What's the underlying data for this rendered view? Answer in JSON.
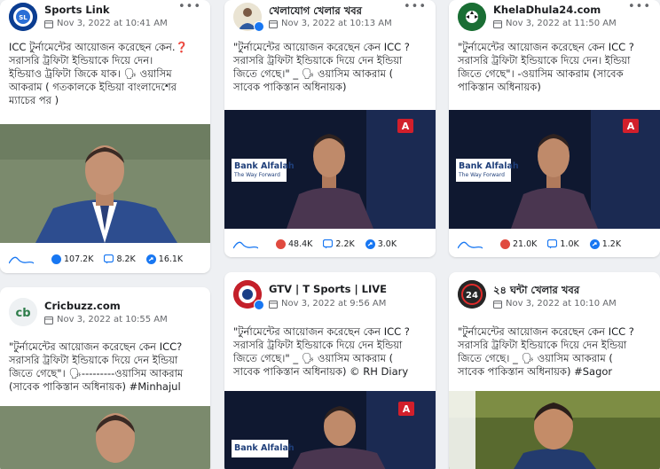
{
  "posts": [
    {
      "page_name": "Sports Link",
      "timestamp": "Nov 3, 2022 at 10:41 AM",
      "text": "ICC টুর্নামেন্টের আয়োজন করেছেন কেন.❓\nসরাসরি ট্রফিটা ইন্ডিয়াকে দিয়ে দেন।\nইন্ডিয়াও ট্রফিটা জিকে যাক। 🗣 ওয়াসিম\nআকরাম ( গতকালকে ইন্ডিয়া বাংলাদেশের\nম্যাচের পর )",
      "reactions": "107.2K",
      "comments": "8.2K",
      "shares": "16.1K"
    },
    {
      "page_name": "খেলাযোগ খেলার খবর",
      "timestamp": "Nov 3, 2022 at 10:13 AM",
      "text": "\"টুর্নামেন্টের আয়োজন করেছেন কেন ICC ?\nসরাসরি ট্রফিটা ইন্ডিয়াকে দিয়ে দেন ইন্ডিয়া\nজিতে গেছে।\" _ 🗣 ওয়াসিম আকরাম (\nসাবেক পাকিস্তান অধিনায়ক)",
      "reactions": "48.4K",
      "comments": "2.2K",
      "shares": "3.0K",
      "video_banner": "Bank Alfalah",
      "video_tagline": "The Way Forward"
    },
    {
      "page_name": "KhelaDhula24.com",
      "timestamp": "Nov 3, 2022 at 11:50 AM",
      "text": "\"টুর্নামেন্টের আয়োজন করেছেন কেন ICC ?\nসরাসরি ট্রফিটা ইন্ডিয়াকে দিয়ে দেন। ইন্ডিয়া\nজিতে গেছে\"। -ওয়াসিম আকরাম (সাবেক\nপাকিস্তান অধিনায়ক)",
      "reactions": "21.0K",
      "comments": "1.0K",
      "shares": "1.2K",
      "video_banner": "Bank Alfalah",
      "video_tagline": "The Way Forward"
    },
    {
      "page_name": "Cricbuzz.com",
      "timestamp": "Nov 3, 2022 at 10:55 AM",
      "text": "\"টুর্নামেন্টের আয়োজন করেছেন কেন ICC?\nসরাসরি ট্রফিটা ইন্ডিয়াকে দিয়ে দেন ইন্ডিয়া\nজিতে গেছে\"। 🗣---------ওয়াসিম আকরাম\n(সাবেক পাকিস্তান অধিনায়ক) #Minhajul"
    },
    {
      "page_name": "GTV | T Sports | LIVE",
      "timestamp": "Nov 3, 2022 at 9:56 AM",
      "text": "\"টুর্নামেন্টের আয়োজন করেছেন কেন ICC ?\nসরাসরি ট্রফিটা ইন্ডিয়াকে দিয়ে দেন ইন্ডিয়া\nজিতে গেছে।\" _ 🗣 ওয়াসিম আকরাম (\nসাবেক পাকিস্তান অধিনায়ক) © RH Diary",
      "video_banner": "Bank Alfalah"
    },
    {
      "page_name": "২৪ ঘন্টা খেলার খবর",
      "timestamp": "Nov 3, 2022 at 10:10 AM",
      "text": "\"টুর্নামেন্টের আয়োজন করেছেন কেন ICC ?\nসরাসরি ট্রফিটা ইন্ডিয়াকে দিয়ে দেন ইন্ডিয়া\nজিতে গেছে। _ 🗣 ওয়াসিম আকরাম (\nসাবেক পাকিস্তান অধিনায়ক) #Sagor"
    }
  ],
  "colors": {
    "page_bg": "#eef0f3",
    "meta_gray": "#65676b",
    "facebook_blue": "#1877f2",
    "studio_dark": "#111a30"
  }
}
